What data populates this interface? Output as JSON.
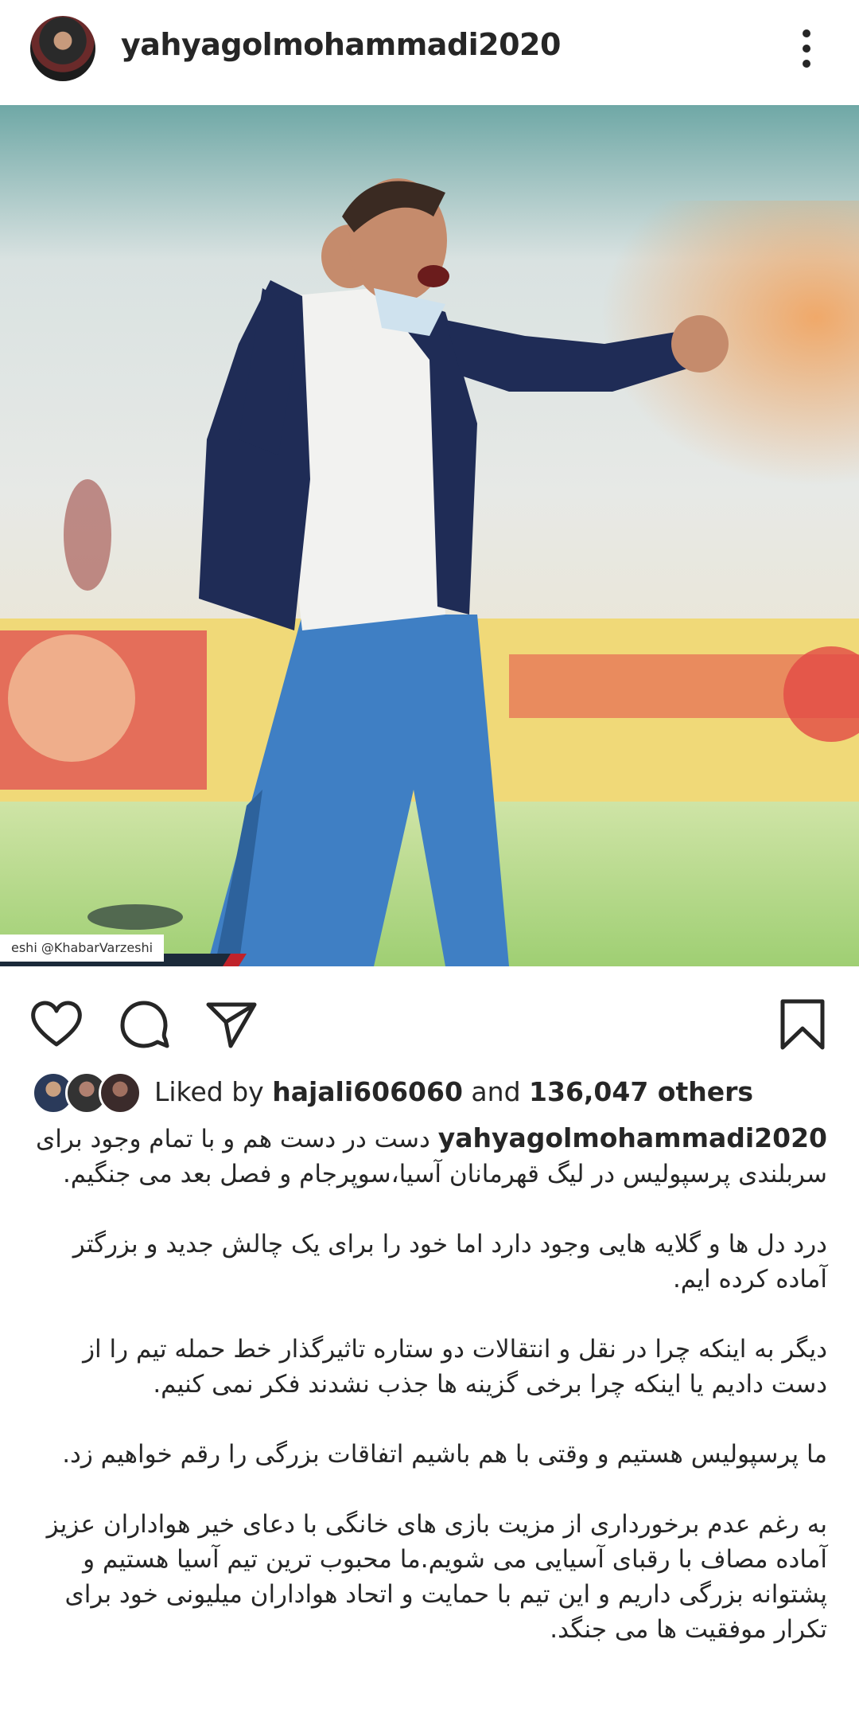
{
  "post": {
    "username": "yahyagolmohammadi2020",
    "watermark": "eshi  @KhabarVarzeshi"
  },
  "icons": {
    "more": "more-vertical-icon",
    "like": "heart-icon",
    "comment": "comment-icon",
    "share": "send-icon",
    "save": "bookmark-icon"
  },
  "likes": {
    "prefix": "Liked by ",
    "user": "hajali606060",
    "middle": " and ",
    "count": "136,047 others"
  },
  "caption": {
    "first": "دست در دست هم و با تمام وجود برای سربلندی پرسپولیس در لیگ قهرمانان آسیا،سوپرجام و فصل بعد می جنگیم.",
    "paragraphs": [
      "درد دل ها و گلایه هایی وجود دارد اما خود را برای یک چالش جدید و بزرگتر آماده کرده ایم.",
      "دیگر به اینکه چرا در نقل و انتقالات دو ستاره تاثیرگذار خط حمله تیم را از دست دادیم یا  اینکه چرا برخی گزینه ها جذب نشدند فکر نمی کنیم.",
      "ما پرسپولیس هستیم و وقتی با هم باشیم اتفاقات بزرگی را رقم خواهیم زد.",
      "به رغم عدم برخورداری از مزیت بازی های خانگی با دعای خیر هواداران عزیز آماده مصاف با رقبای آسیایی می شویم.ما محبوب ترین تیم آسیا هستیم و پشتوانه بزرگی داریم و این تیم با حمایت و اتحاد هواداران میلیونی خود برای تکرار موفقیت ها می جنگد."
    ]
  }
}
